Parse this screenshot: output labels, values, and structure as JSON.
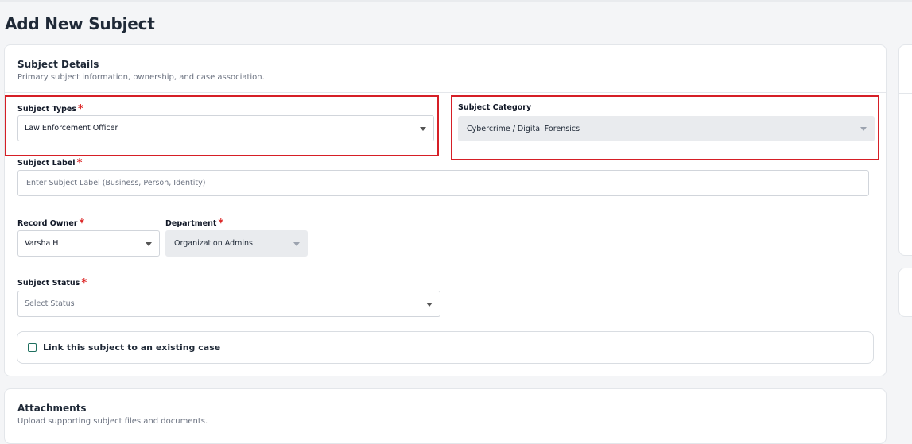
{
  "page": {
    "title": "Add New Subject"
  },
  "subject_details": {
    "title": "Subject Details",
    "subtitle": "Primary subject information, ownership, and case association.",
    "subject_types": {
      "label": "Subject Types",
      "required": "*",
      "value": "Law Enforcement Officer"
    },
    "subject_category": {
      "label": "Subject Category",
      "value": "Cybercrime / Digital Forensics"
    },
    "subject_label": {
      "label": "Subject Label",
      "required": "*",
      "placeholder": "Enter Subject Label (Business, Person, Identity)"
    },
    "record_owner": {
      "label": "Record Owner",
      "required": "*",
      "value": "Varsha H"
    },
    "department": {
      "label": "Department",
      "required": "*",
      "value": "Organization Admins"
    },
    "subject_status": {
      "label": "Subject Status",
      "required": "*",
      "placeholder": "Select Status"
    },
    "link_case": {
      "label": "Link this subject to an existing case",
      "checked": false
    }
  },
  "attachments": {
    "title": "Attachments",
    "subtitle": "Upload supporting subject files and documents."
  },
  "colors": {
    "highlight": "#d61f26",
    "required": "#dc2626",
    "checkbox_border": "#1f6f5f"
  }
}
